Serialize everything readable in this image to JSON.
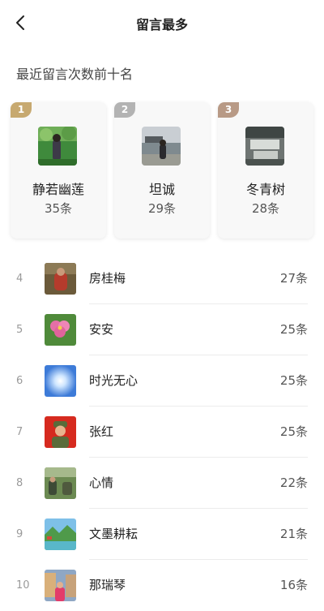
{
  "header": {
    "title": "留言最多",
    "back_icon": "back-arrow-icon"
  },
  "subtitle": "最近留言次数前十名",
  "colors": {
    "rank1": "#c7a970",
    "rank2": "#b3b3b3",
    "rank3": "#b89a86"
  },
  "top3": [
    {
      "rank": "1",
      "name": "静若幽莲",
      "count": "35条"
    },
    {
      "rank": "2",
      "name": "坦诚",
      "count": "29条"
    },
    {
      "rank": "3",
      "name": "冬青树",
      "count": "28条"
    }
  ],
  "list": [
    {
      "rank": "4",
      "name": "房桂梅",
      "count": "27条"
    },
    {
      "rank": "5",
      "name": "安安",
      "count": "25条"
    },
    {
      "rank": "6",
      "name": "时光无心",
      "count": "25条"
    },
    {
      "rank": "7",
      "name": "张红",
      "count": "25条"
    },
    {
      "rank": "8",
      "name": "心情",
      "count": "22条"
    },
    {
      "rank": "9",
      "name": "文墨耕耘",
      "count": "21条"
    },
    {
      "rank": "10",
      "name": "那瑞琴",
      "count": "16条"
    }
  ]
}
